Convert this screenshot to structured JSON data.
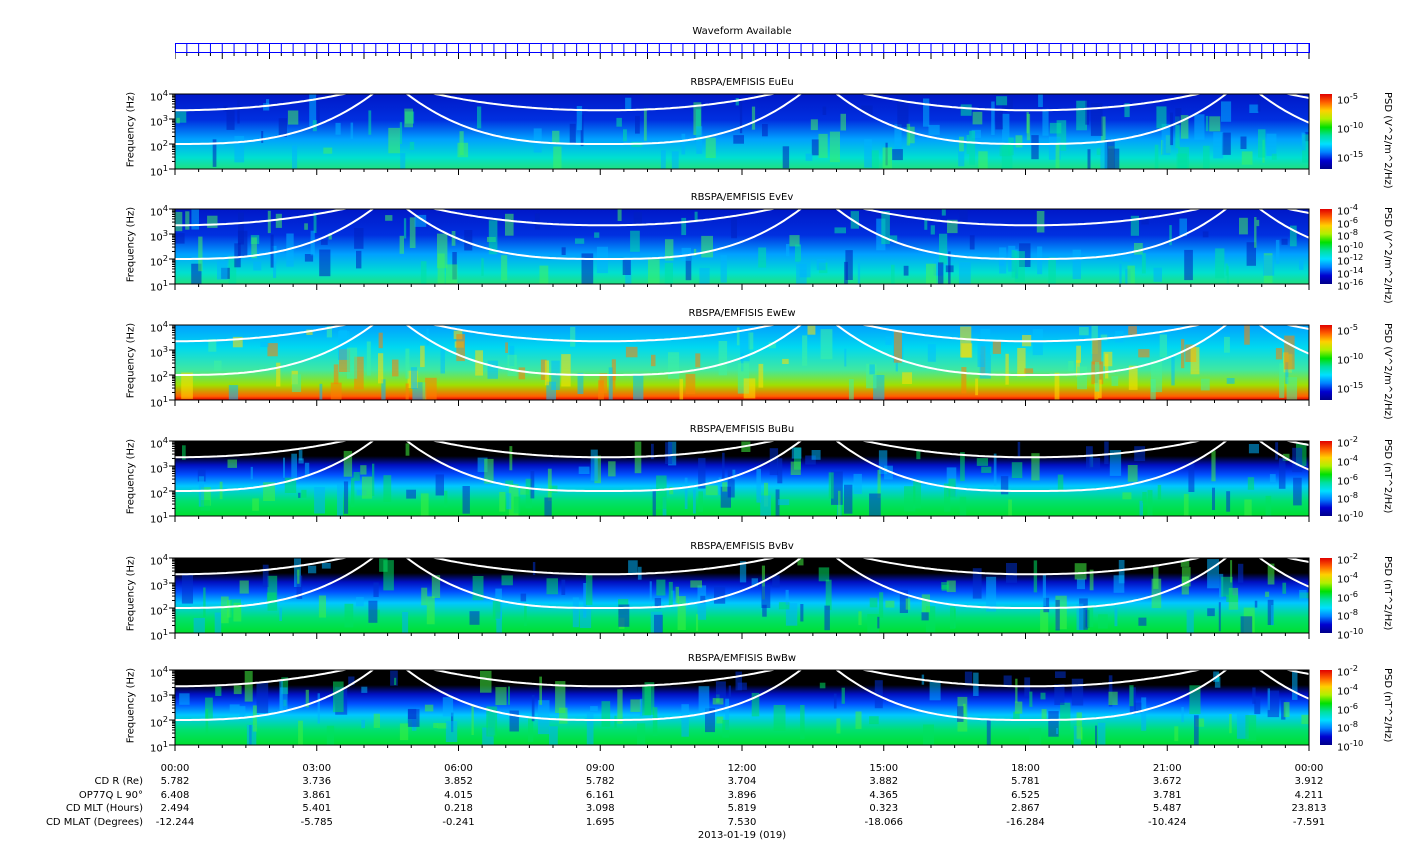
{
  "waveform": {
    "title": "Waveform Available",
    "color": "#0000ff"
  },
  "panels": [
    {
      "title": "RBSPA/EMFISIS  EuEu",
      "type": "E",
      "ylabel": "Frequency (Hz)",
      "cb_label": "PSD (V^2/m^2/Hz)",
      "cb_ticks": [
        "10-5",
        "10-10",
        "10-15"
      ]
    },
    {
      "title": "RBSPA/EMFISIS  EvEv",
      "type": "E",
      "ylabel": "Frequency (Hz)",
      "cb_label": "PSD (V^2/m^2/Hz)",
      "cb_ticks": [
        "10-4",
        "10-6",
        "10-8",
        "10-10",
        "10-12",
        "10-14",
        "10-16"
      ]
    },
    {
      "title": "RBSPA/EMFISIS  EwEw",
      "type": "EW",
      "ylabel": "Frequency (Hz)",
      "cb_label": "PSD (V^2/m^2/Hz)",
      "cb_ticks": [
        "10-5",
        "10-10",
        "10-15"
      ]
    },
    {
      "title": "RBSPA/EMFISIS  BuBu",
      "type": "B",
      "ylabel": "Frequency (Hz)",
      "cb_label": "PSD (nT^2/Hz)",
      "cb_ticks": [
        "10-2",
        "10-4",
        "10-6",
        "10-8",
        "10-10"
      ]
    },
    {
      "title": "RBSPA/EMFISIS  BvBv",
      "type": "B",
      "ylabel": "Frequency (Hz)",
      "cb_label": "PSD (nT^2/Hz)",
      "cb_ticks": [
        "10-2",
        "10-4",
        "10-6",
        "10-8",
        "10-10"
      ]
    },
    {
      "title": "RBSPA/EMFISIS  BwBw",
      "type": "B",
      "ylabel": "Frequency (Hz)",
      "cb_label": "PSD (nT^2/Hz)",
      "cb_ticks": [
        "10-2",
        "10-4",
        "10-6",
        "10-8",
        "10-10"
      ]
    }
  ],
  "chart_data": {
    "type": "heatmap",
    "xlabel": "2013-01-19 (019)",
    "xlim_hours": [
      0,
      24
    ],
    "ylim_log10_hz": [
      1,
      4
    ],
    "ytick_labels": [
      "10^4",
      "10^3",
      "10^2",
      "10^1"
    ],
    "xtick_labels": [
      "00:00",
      "03:00",
      "06:00",
      "09:00",
      "12:00",
      "15:00",
      "18:00",
      "21:00",
      "00:00"
    ],
    "perigee_hours": [
      4.5,
      13.6,
      22.6
    ]
  },
  "ephemeris": {
    "rows": [
      {
        "label": "CD R (Re)",
        "values": [
          "5.782",
          "3.736",
          "3.852",
          "5.782",
          "3.704",
          "3.882",
          "5.781",
          "3.672",
          "3.912"
        ]
      },
      {
        "label": "OP77Q L 90°",
        "values": [
          "6.408",
          "3.861",
          "4.015",
          "6.161",
          "3.896",
          "4.365",
          "6.525",
          "3.781",
          "4.211"
        ]
      },
      {
        "label": "CD MLT (Hours)",
        "values": [
          "2.494",
          "5.401",
          "0.218",
          "3.098",
          "5.819",
          "0.323",
          "2.867",
          "5.487",
          "23.813"
        ]
      },
      {
        "label": "CD MLAT (Degrees)",
        "values": [
          "-12.244",
          "-5.785",
          "-0.241",
          "1.695",
          "7.530",
          "-18.066",
          "-16.284",
          "-10.424",
          "-7.591"
        ]
      }
    ],
    "date": "2013-01-19 (019)"
  }
}
